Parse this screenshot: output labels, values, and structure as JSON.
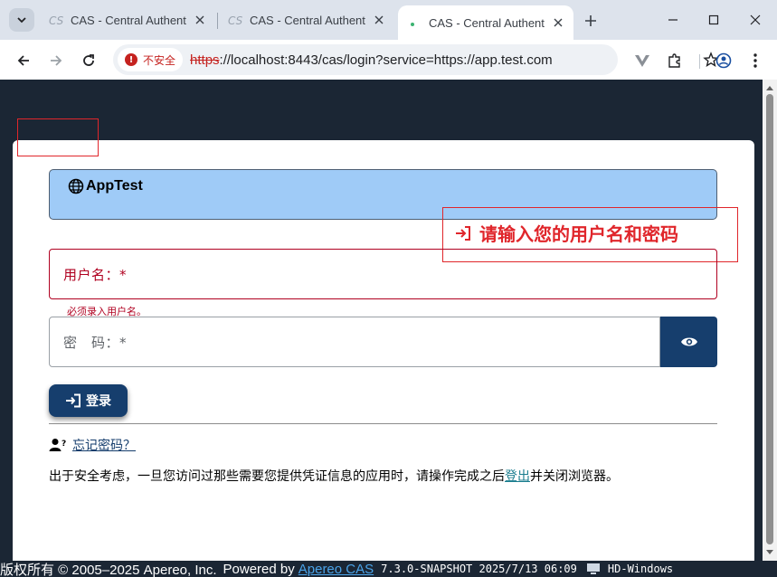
{
  "browser": {
    "tabs": [
      {
        "title": "CAS - Central Authenti",
        "active": false
      },
      {
        "title": "CAS - Central Authenti",
        "active": false
      },
      {
        "title": "CAS - Central Authenti",
        "active": true
      }
    ],
    "security_label": "不安全",
    "url_scheme": "https",
    "url_rest": "://localhost:8443/cas/login?service=https://app.test.com"
  },
  "banner": {
    "title": "AppTest"
  },
  "callout": {
    "text": "请输入您的用户名和密码"
  },
  "form": {
    "username_label": "用户名：*",
    "username_error": "必须录入用户名。",
    "password_label": "密　码：*",
    "login_label": "登录",
    "forgot_label": "忘记密码？"
  },
  "notice": {
    "before": "出于安全考虑，一旦您访问过那些需要您提供凭证信息的应用时，请操作完成之后",
    "link": "登出",
    "after": "并关闭浏览器。"
  },
  "footer": {
    "copyright": "版权所有 © 2005–2025 Apereo, Inc.",
    "powered_by": "Powered by",
    "powered_link": "Apereo CAS",
    "version": "7.3.0-SNAPSHOT 2025/7/13 06:09",
    "host": "HD-Windows"
  },
  "colors": {
    "header_bg": "#1b2634",
    "primary": "#163e6d",
    "banner_bg": "#9fcbf7",
    "error": "#b00020",
    "annotation": "#e0262b"
  }
}
